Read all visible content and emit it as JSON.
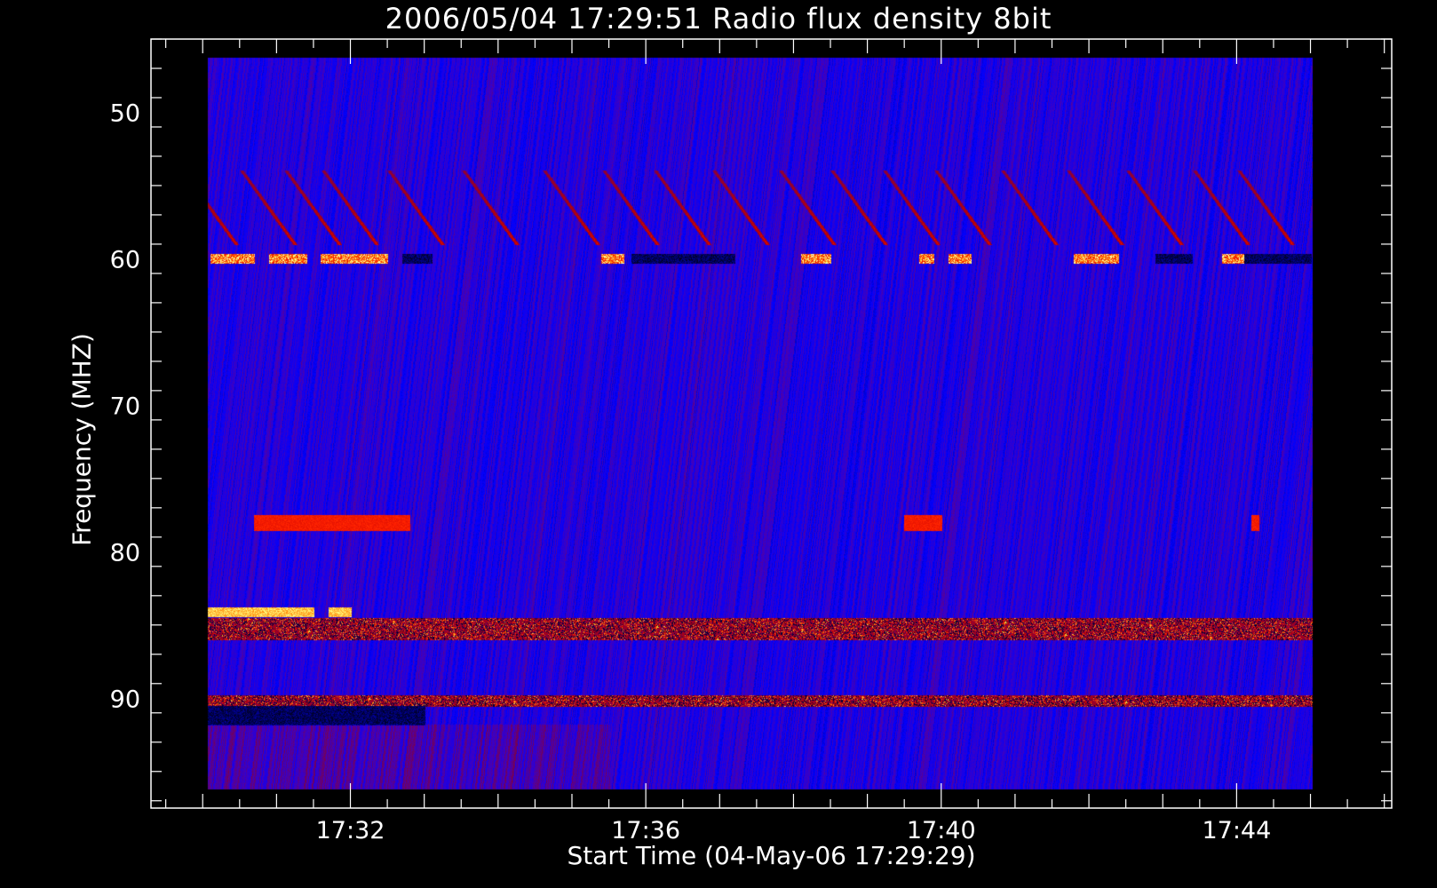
{
  "chart_data": {
    "type": "heatmap",
    "title": "2006/05/04 17:29:51 Radio flux density 8bit",
    "xlabel": "Start Time (04-May-06 17:29:29)",
    "ylabel": "Frequency (MHZ)",
    "x_ticks": [
      "17:32",
      "17:36",
      "17:40",
      "17:44"
    ],
    "x_tick_minutes": [
      32,
      36,
      40,
      44
    ],
    "x_range_minutes": [
      29.3,
      46.1
    ],
    "data_x_range_minutes": [
      30.07,
      45.03
    ],
    "y_ticks": [
      50,
      60,
      70,
      80,
      90
    ],
    "y_range_mhz": [
      45.0,
      97.5
    ],
    "data_y_range_mhz": [
      46.3,
      96.2
    ],
    "y_inverted": true,
    "colormap": [
      "#000000",
      "#000080",
      "#0000ff",
      "#4000c0",
      "#800040",
      "#c00000",
      "#ff2000",
      "#ff8000",
      "#ffff80",
      "#ffffff"
    ],
    "background_level": 0.28,
    "features": [
      {
        "kind": "type-III burst drifts",
        "freq_mhz": [
          54,
          59
        ],
        "times_min": [
          30.1,
          30.9,
          31.5,
          32.0,
          32.9,
          33.9,
          35.0,
          35.8,
          36.5,
          37.3,
          38.2,
          38.9,
          39.6,
          40.3,
          41.2,
          42.1,
          42.9,
          43.8,
          44.4
        ]
      },
      {
        "kind": "bright band",
        "freq_mhz": 60,
        "intervals_min": [
          [
            30.1,
            30.7
          ],
          [
            30.9,
            31.4
          ],
          [
            31.6,
            32.5
          ],
          [
            35.4,
            35.7
          ],
          [
            38.1,
            38.5
          ],
          [
            39.7,
            39.9
          ],
          [
            40.1,
            40.4
          ],
          [
            41.8,
            42.4
          ],
          [
            43.8,
            44.1
          ]
        ]
      },
      {
        "kind": "dark band",
        "freq_mhz": 60,
        "intervals_min": [
          [
            32.7,
            33.1
          ],
          [
            35.8,
            37.2
          ],
          [
            42.9,
            43.4
          ],
          [
            44.1,
            45.0
          ]
        ]
      },
      {
        "kind": "red block",
        "freq_mhz": [
          77.5,
          78.5
        ],
        "intervals_min": [
          [
            30.7,
            31.6
          ],
          [
            31.6,
            32.8
          ],
          [
            39.5,
            40.0
          ],
          [
            44.2,
            44.3
          ]
        ]
      },
      {
        "kind": "yellow band",
        "freq_mhz": [
          83.8,
          84.4
        ],
        "intervals_min": [
          [
            30.07,
            31.5
          ],
          [
            31.7,
            32.0
          ]
        ]
      },
      {
        "kind": "speckled band",
        "freq_mhz": [
          84.5,
          86.0
        ],
        "intervals_min": [
          [
            30.07,
            45.03
          ]
        ]
      },
      {
        "kind": "speckled band",
        "freq_mhz": [
          89.8,
          90.5
        ],
        "intervals_min": [
          [
            30.07,
            45.03
          ]
        ]
      },
      {
        "kind": "dark band",
        "freq_mhz": [
          90.5,
          91.8
        ],
        "intervals_min": [
          [
            30.07,
            33.0
          ]
        ]
      },
      {
        "kind": "reddish block",
        "freq_mhz": [
          91.8,
          96.2
        ],
        "intervals_min": [
          [
            30.07,
            35.5
          ]
        ]
      }
    ]
  }
}
